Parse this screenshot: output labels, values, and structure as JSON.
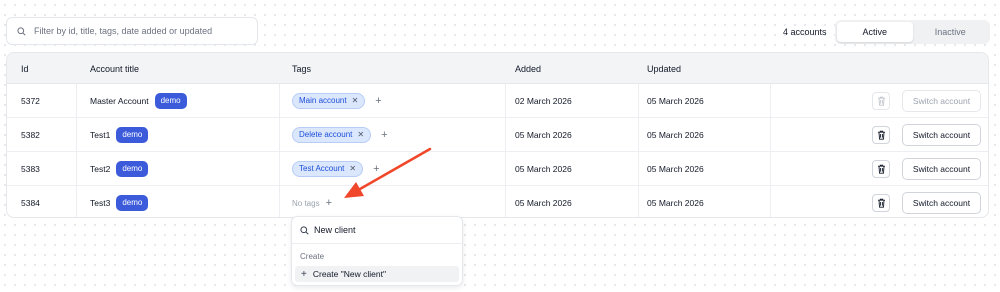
{
  "filter": {
    "placeholder": "Filter by id, title, tags, date added or updated"
  },
  "accounts_count": "4 accounts",
  "status_toggle": {
    "active": "Active",
    "inactive": "Inactive",
    "selected": "Active"
  },
  "table": {
    "headers": {
      "id": "Id",
      "title": "Account title",
      "tags": "Tags",
      "added": "Added",
      "updated": "Updated"
    },
    "rows": [
      {
        "id": "5372",
        "title": "Master Account",
        "badge": "demo",
        "tag": "Main account",
        "added": "02 March 2026",
        "updated": "05 March 2026",
        "action": "Switch account"
      },
      {
        "id": "5382",
        "title": "Test1",
        "badge": "demo",
        "tag": "Delete account",
        "added": "05 March 2026",
        "updated": "05 March 2026",
        "action": "Switch account"
      },
      {
        "id": "5383",
        "title": "Test2",
        "badge": "demo",
        "tag": "Test Account",
        "added": "05 March 2026",
        "updated": "05 March 2026",
        "action": "Switch account"
      },
      {
        "id": "5384",
        "title": "Test3",
        "badge": "demo",
        "no_tags": "No tags",
        "added": "05 March 2026",
        "updated": "05 March 2026",
        "action": "Switch account"
      }
    ]
  },
  "tag_popover": {
    "search_value": "New client",
    "section": "Create",
    "create_label": "Create \"New client\""
  },
  "colors": {
    "badge": "#3b5bdb",
    "tag_bg": "#dbe7fd",
    "arrow": "#f0472b"
  },
  "icons": {
    "search": "search-icon",
    "trash": "trash-icon",
    "plus": "plus-icon",
    "remove": "x-icon"
  }
}
